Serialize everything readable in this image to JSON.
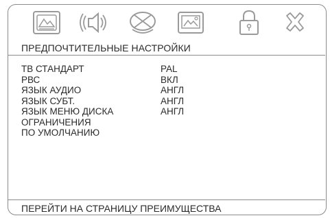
{
  "toolbar": {
    "icons": [
      {
        "name": "general-setup-icon"
      },
      {
        "name": "audio-setup-icon"
      },
      {
        "name": "dolby-setup-icon"
      },
      {
        "name": "video-setup-icon"
      },
      {
        "name": "password-lock-icon"
      },
      {
        "name": "exit-icon"
      }
    ]
  },
  "page": {
    "title": "ПРЕДПОЧТИТЕЛЬНЫЕ НАСТРОЙКИ",
    "footer": "ПЕРЕЙТИ НА СТРАНИЦУ ПРЕИМУЩЕСТВА"
  },
  "settings": [
    {
      "label": "ТВ СТАНДАРТ",
      "value": "PAL"
    },
    {
      "label": "РВС",
      "value": "ВКЛ"
    },
    {
      "label": "ЯЗЫК АУДИО",
      "value": "АНГЛ"
    },
    {
      "label": "ЯЗЫК СУБТ.",
      "value": "АНГЛ"
    },
    {
      "label": "ЯЗЫК МЕНЮ ДИСКА",
      "value": "АНГЛ"
    },
    {
      "label": "ОГРАНИЧЕНИЯ",
      "value": ""
    },
    {
      "label": "ПО УМОЛЧАНИЮ",
      "value": ""
    }
  ],
  "colors": {
    "border": "#8a8a8a",
    "text": "#2a2a2a",
    "icon_stroke": "#9a9a9a"
  }
}
